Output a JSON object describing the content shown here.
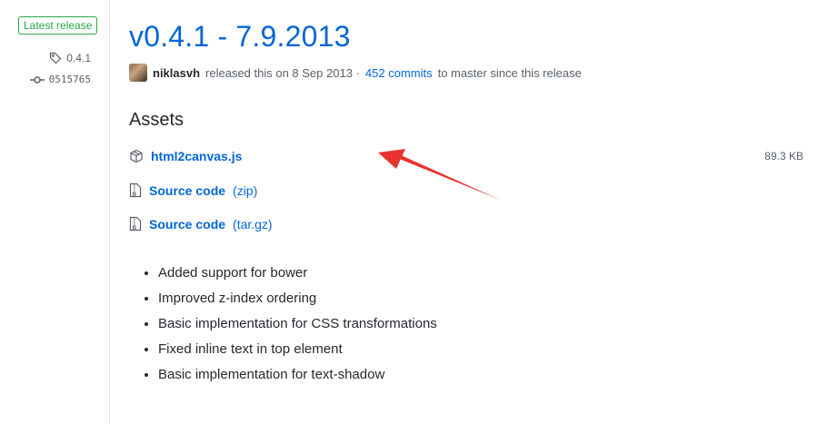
{
  "sidebar": {
    "badge": "Latest release",
    "tag": "0.4.1",
    "commit": "0515765"
  },
  "release": {
    "title": "v0.4.1 - 7.9.2013",
    "author": "niklasvh",
    "released_text": "released this on 8 Sep 2013 ·",
    "commits_link": "452 commits",
    "since_text": "to master since this release"
  },
  "assets": {
    "heading": "Assets",
    "items": [
      {
        "name": "html2canvas.js",
        "ext": "",
        "size": "89.3 KB",
        "icon": "package-icon"
      },
      {
        "name": "Source code",
        "ext": "(zip)",
        "icon": "file-zip-icon"
      },
      {
        "name": "Source code",
        "ext": "(tar.gz)",
        "icon": "file-zip-icon"
      }
    ]
  },
  "notes": [
    "Added support for bower",
    "Improved z-index ordering",
    "Basic implementation for CSS transformations",
    "Fixed inline text in top element",
    "Basic implementation for text-shadow"
  ],
  "colors": {
    "link": "#0366d6",
    "badge_green": "#28a745",
    "annotation_red": "#e8332f"
  }
}
